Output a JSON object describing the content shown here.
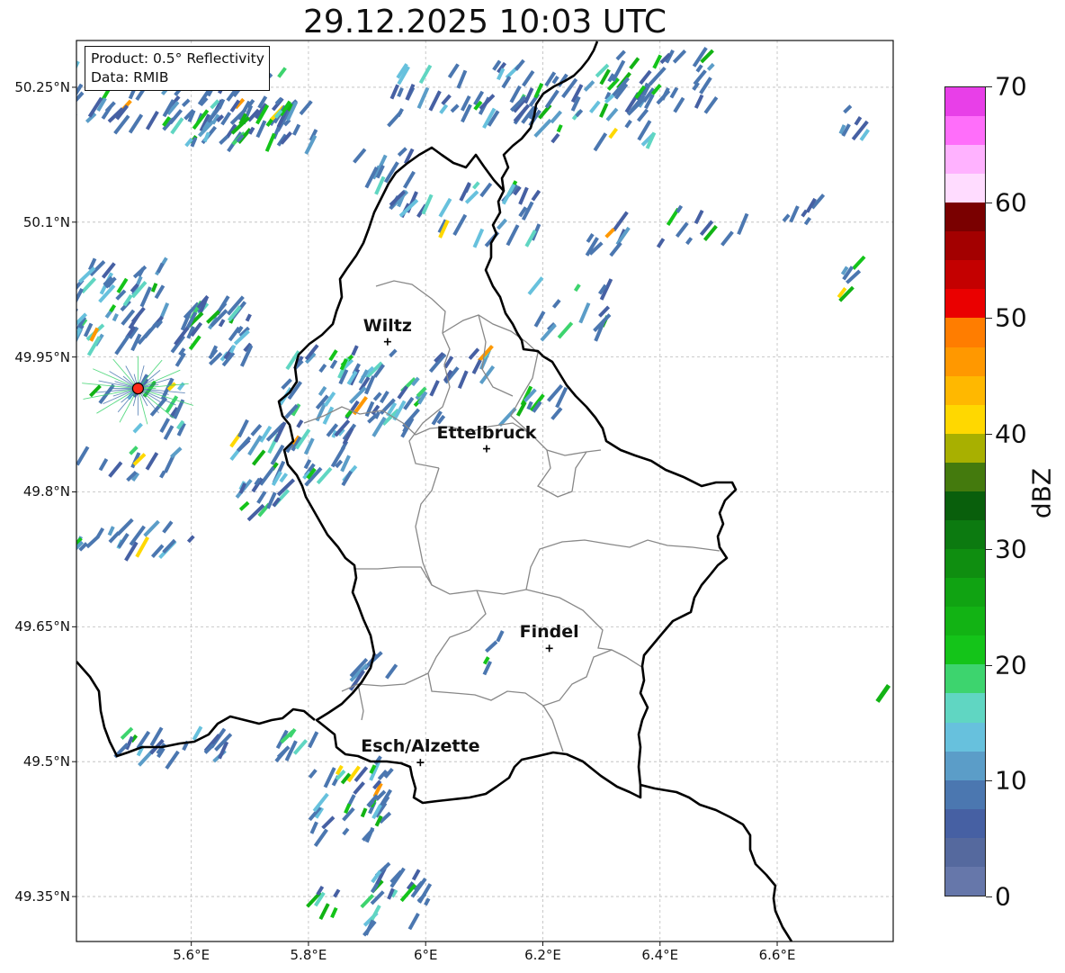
{
  "title": "29.12.2025 10:03 UTC",
  "info": {
    "product": "Product: 0.5° Reflectivity",
    "data": "Data: RMIB"
  },
  "axes": {
    "lon_range": [
      5.404,
      6.798
    ],
    "lat_range": [
      49.3,
      50.302
    ],
    "lat_ticks": [
      {
        "value": 50.25,
        "label": "50.25°N"
      },
      {
        "value": 50.1,
        "label": "50.1°N"
      },
      {
        "value": 49.95,
        "label": "49.95°N"
      },
      {
        "value": 49.8,
        "label": "49.8°N"
      },
      {
        "value": 49.65,
        "label": "49.65°N"
      },
      {
        "value": 49.5,
        "label": "49.5°N"
      },
      {
        "value": 49.35,
        "label": "49.35°N"
      }
    ],
    "lon_ticks": [
      {
        "value": 5.6,
        "label": "5.6°E"
      },
      {
        "value": 5.8,
        "label": "5.8°E"
      },
      {
        "value": 6.0,
        "label": "6°E"
      },
      {
        "value": 6.2,
        "label": "6.2°E"
      },
      {
        "value": 6.4,
        "label": "6.4°E"
      },
      {
        "value": 6.6,
        "label": "6.6°E"
      }
    ]
  },
  "cities": [
    {
      "name": "Wiltz",
      "lon": 5.935,
      "lat": 49.967
    },
    {
      "name": "Ettelbruck",
      "lon": 6.104,
      "lat": 49.848
    },
    {
      "name": "Findel",
      "lon": 6.211,
      "lat": 49.626
    },
    {
      "name": "Esch/Alzette",
      "lon": 5.991,
      "lat": 49.499
    }
  ],
  "radar_site": {
    "lon": 5.509,
    "lat": 49.915,
    "color": "#ff2a1a"
  },
  "colorbar": {
    "label": "dBZ",
    "min": 0,
    "max": 70,
    "step": 2.5,
    "ticks": [
      "0",
      "10",
      "20",
      "30",
      "40",
      "50",
      "60",
      "70"
    ],
    "colors": [
      "#6677aa",
      "#55699e",
      "#4660a3",
      "#4b77b0",
      "#5b9dc8",
      "#67c1dd",
      "#60d6c2",
      "#3dd46e",
      "#14c419",
      "#12b314",
      "#10a312",
      "#0f8e10",
      "#0c7a10",
      "#095f0c",
      "#447a0d",
      "#a8b000",
      "#ffd800",
      "#ffb800",
      "#ff9800",
      "#ff7d00",
      "#ea0000",
      "#c40000",
      "#a30000",
      "#7a0000",
      "#ffdcff",
      "#ffb2ff",
      "#ff6efa",
      "#e83fe8"
    ]
  }
}
